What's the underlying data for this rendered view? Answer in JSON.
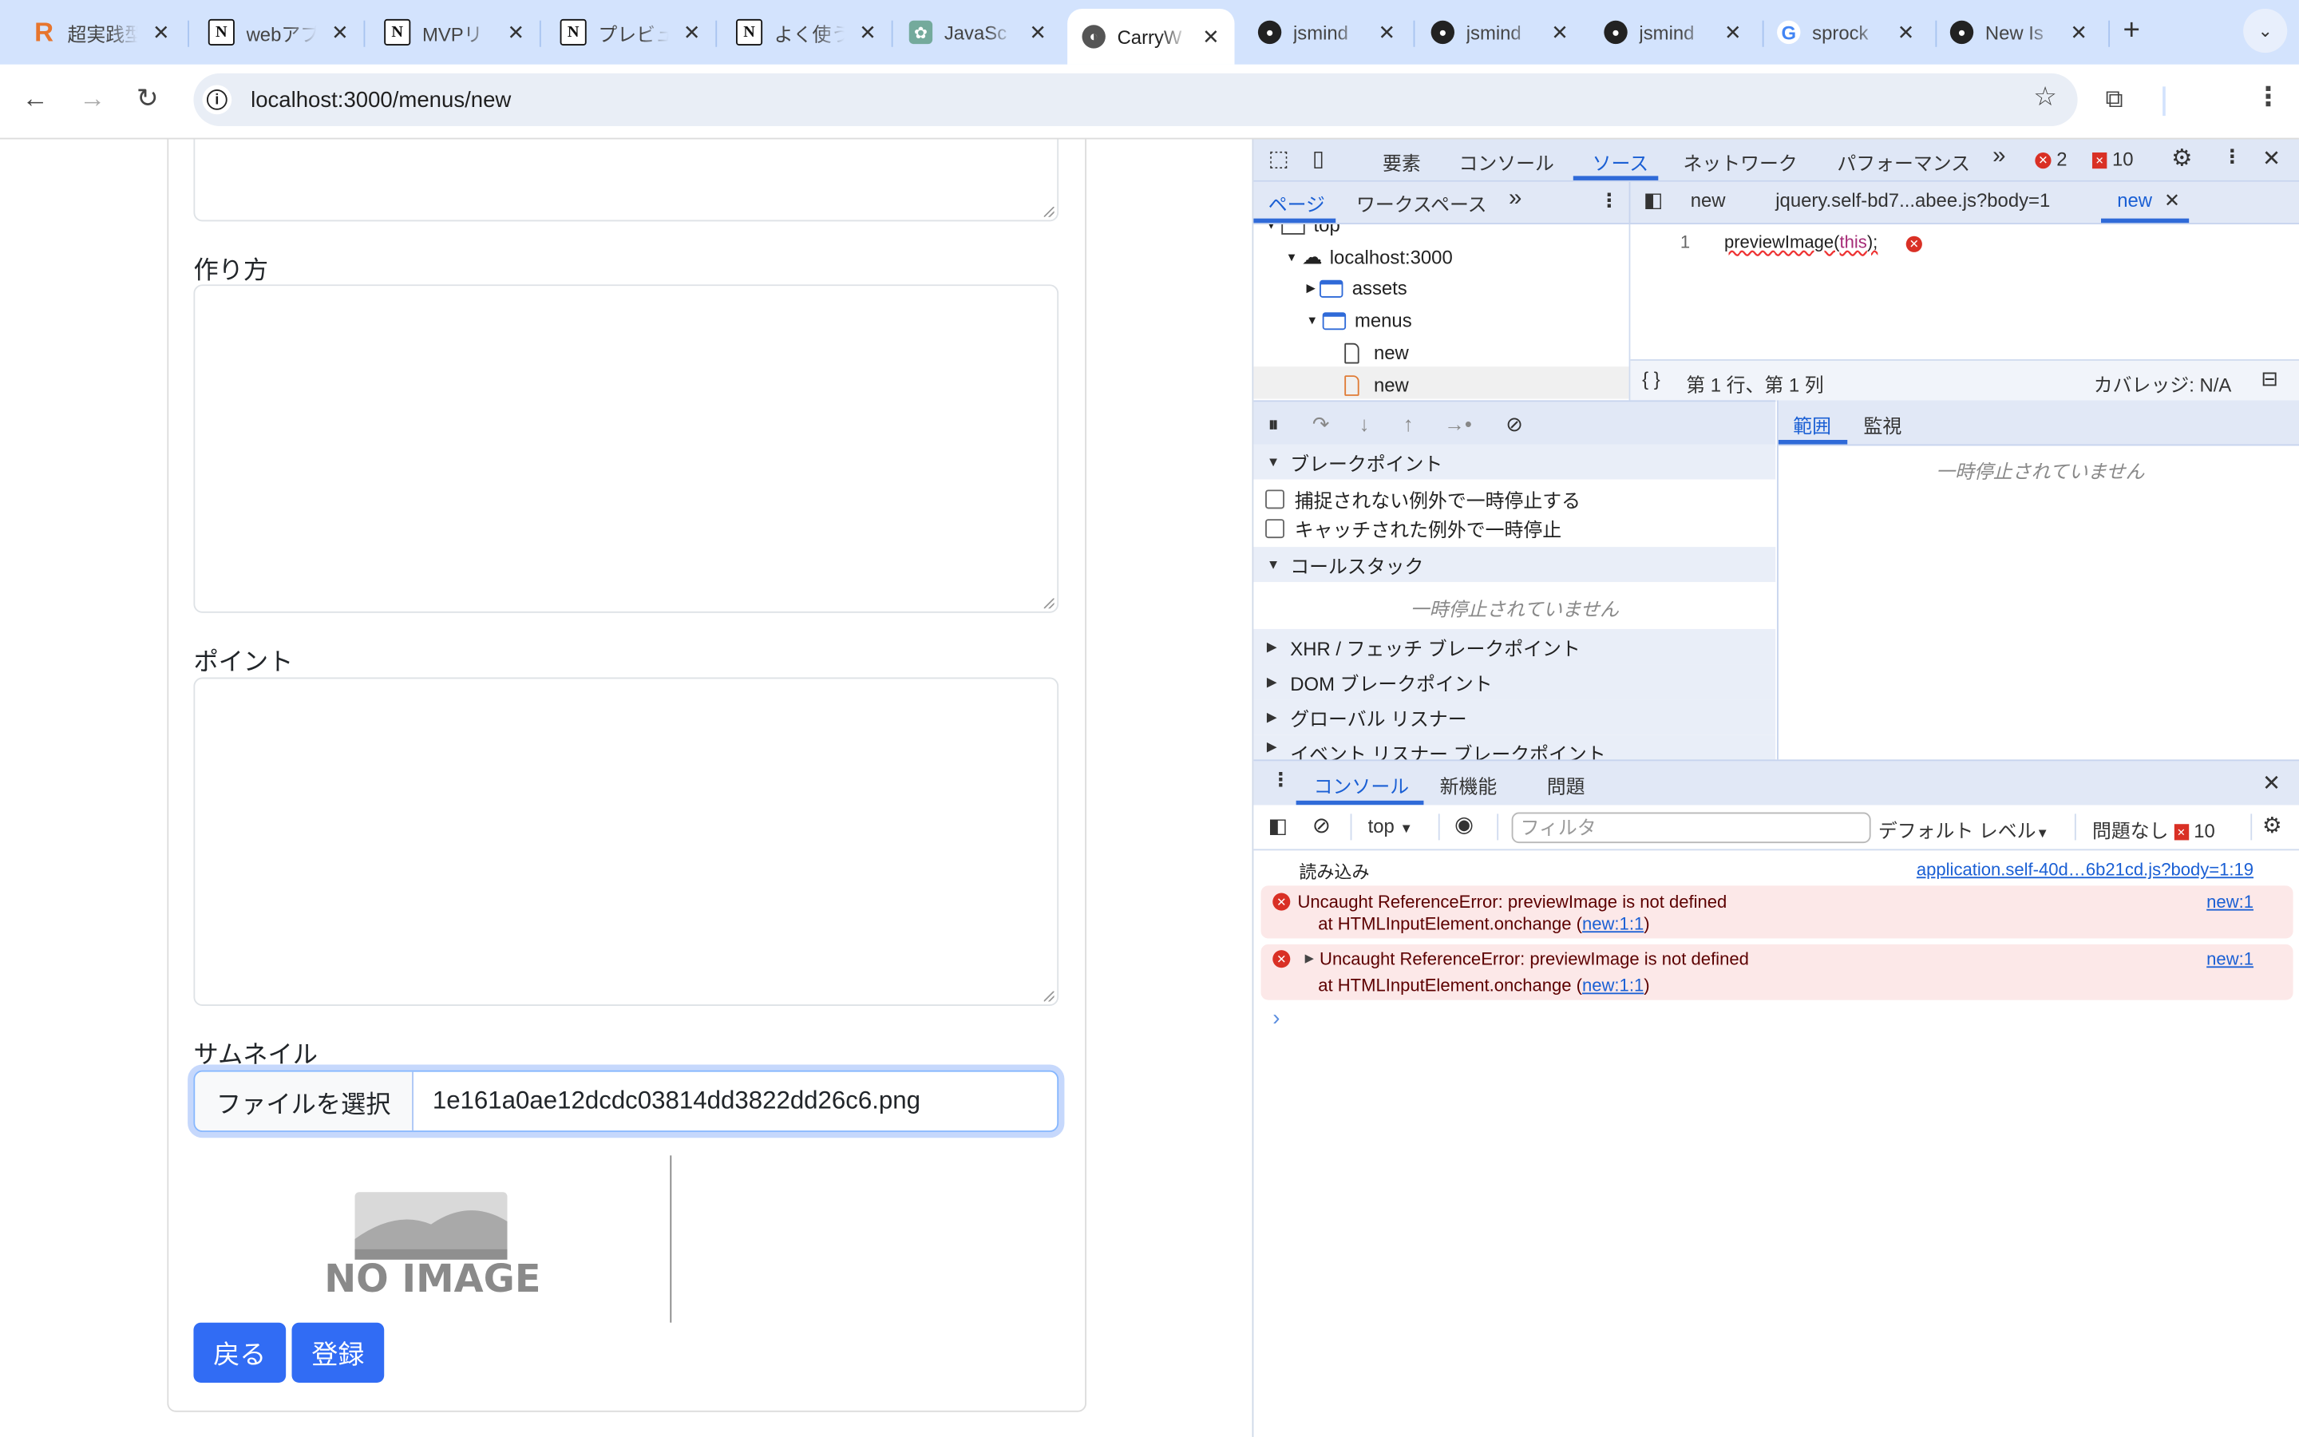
{
  "browser": {
    "tabs": [
      {
        "title": "超実践型",
        "favicon": "r-logo-icon",
        "active": false
      },
      {
        "title": "webアプ",
        "favicon": "notion-icon",
        "active": false
      },
      {
        "title": "MVPリ",
        "favicon": "notion-icon",
        "active": false
      },
      {
        "title": "プレビュ",
        "favicon": "notion-icon",
        "active": false
      },
      {
        "title": "よく使う",
        "favicon": "notion-icon",
        "active": false
      },
      {
        "title": "JavaSc",
        "favicon": "chatgpt-icon",
        "active": false
      },
      {
        "title": "CarryW",
        "favicon": "globe-icon",
        "active": true
      },
      {
        "title": "jsmind",
        "favicon": "github-icon",
        "active": false
      },
      {
        "title": "jsmind",
        "favicon": "github-icon",
        "active": false
      },
      {
        "title": "jsmind",
        "favicon": "github-icon",
        "active": false
      },
      {
        "title": "sprock",
        "favicon": "google-icon",
        "active": false
      },
      {
        "title": "New Is",
        "favicon": "github-icon",
        "active": false
      }
    ],
    "close_glyph": "✕",
    "new_tab_glyph": "+",
    "tab_search_glyph": "⌄",
    "url": "localhost:3000/menus/new"
  },
  "page": {
    "fields": {
      "method_label": "作り方",
      "point_label": "ポイント",
      "thumbnail_label": "サムネイル"
    },
    "file_input": {
      "button_label": "ファイルを選択",
      "file_name": "1e161a0ae12dcdc03814dd3822dd26c6.png"
    },
    "preview_image_text": "NO IMAGE",
    "buttons": {
      "back": "戻る",
      "submit": "登録"
    }
  },
  "devtools": {
    "main_tabs": [
      "要素",
      "コンソール",
      "ソース",
      "ネットワーク",
      "パフォーマンス"
    ],
    "active_main_tab": "ソース",
    "more_glyph": "»",
    "error_count": "2",
    "warning_count": "10",
    "sources_nav_tabs": [
      "ページ",
      "ワークスペース"
    ],
    "editor_tabs": [
      {
        "label": "new",
        "active": false
      },
      {
        "label": "jquery.self-bd7...abee.js?body=1",
        "active": false
      },
      {
        "label": "new",
        "active": true
      }
    ],
    "tree": {
      "top": "top",
      "host": "localhost:3000",
      "folders": [
        "assets",
        "menus"
      ],
      "files": [
        "new",
        "new"
      ]
    },
    "editor": {
      "line_number": "1",
      "code_fn": "previewImage(",
      "code_this": "this",
      "code_end": ");"
    },
    "status": {
      "position": "第 1 行、第 1 列",
      "coverage": "カバレッジ: N/A"
    },
    "debugger": {
      "breakpoints_header": "ブレークポイント",
      "pause_uncaught": "捕捉されない例外で一時停止する",
      "pause_caught": "キャッチされた例外で一時停止",
      "callstack_header": "コールスタック",
      "not_paused": "一時停止されていません",
      "sections": [
        "XHR / フェッチ ブレークポイント",
        "DOM ブレークポイント",
        "グローバル リスナー",
        "イベント リスナー ブレークポイント"
      ]
    },
    "scope": {
      "tabs": [
        "範囲",
        "監視"
      ],
      "not_paused": "一時停止されていません"
    },
    "drawer": {
      "tabs": [
        "コンソール",
        "新機能",
        "問題"
      ]
    },
    "console": {
      "context": "top",
      "filter_placeholder": "フィルタ",
      "level": "デフォルト レベル",
      "issues": "問題なし",
      "issues_count": "10",
      "messages": [
        {
          "type": "log",
          "text": "読み込み",
          "source": "application.self-40d…6b21cd.js?body=1:19"
        },
        {
          "type": "error",
          "text": "Uncaught ReferenceError: previewImage is not defined",
          "stack_prefix": "at HTMLInputElement.onchange (",
          "stack_link": "new:1:1",
          "stack_suffix": ")",
          "source": "new:1",
          "expandable": false
        },
        {
          "type": "error",
          "text": "Uncaught ReferenceError: previewImage is not defined",
          "stack_prefix": "at HTMLInputElement.onchange (",
          "stack_link": "new:1:1",
          "stack_suffix": ")",
          "source": "new:1",
          "expandable": true
        }
      ],
      "prompt_glyph": "›"
    }
  }
}
